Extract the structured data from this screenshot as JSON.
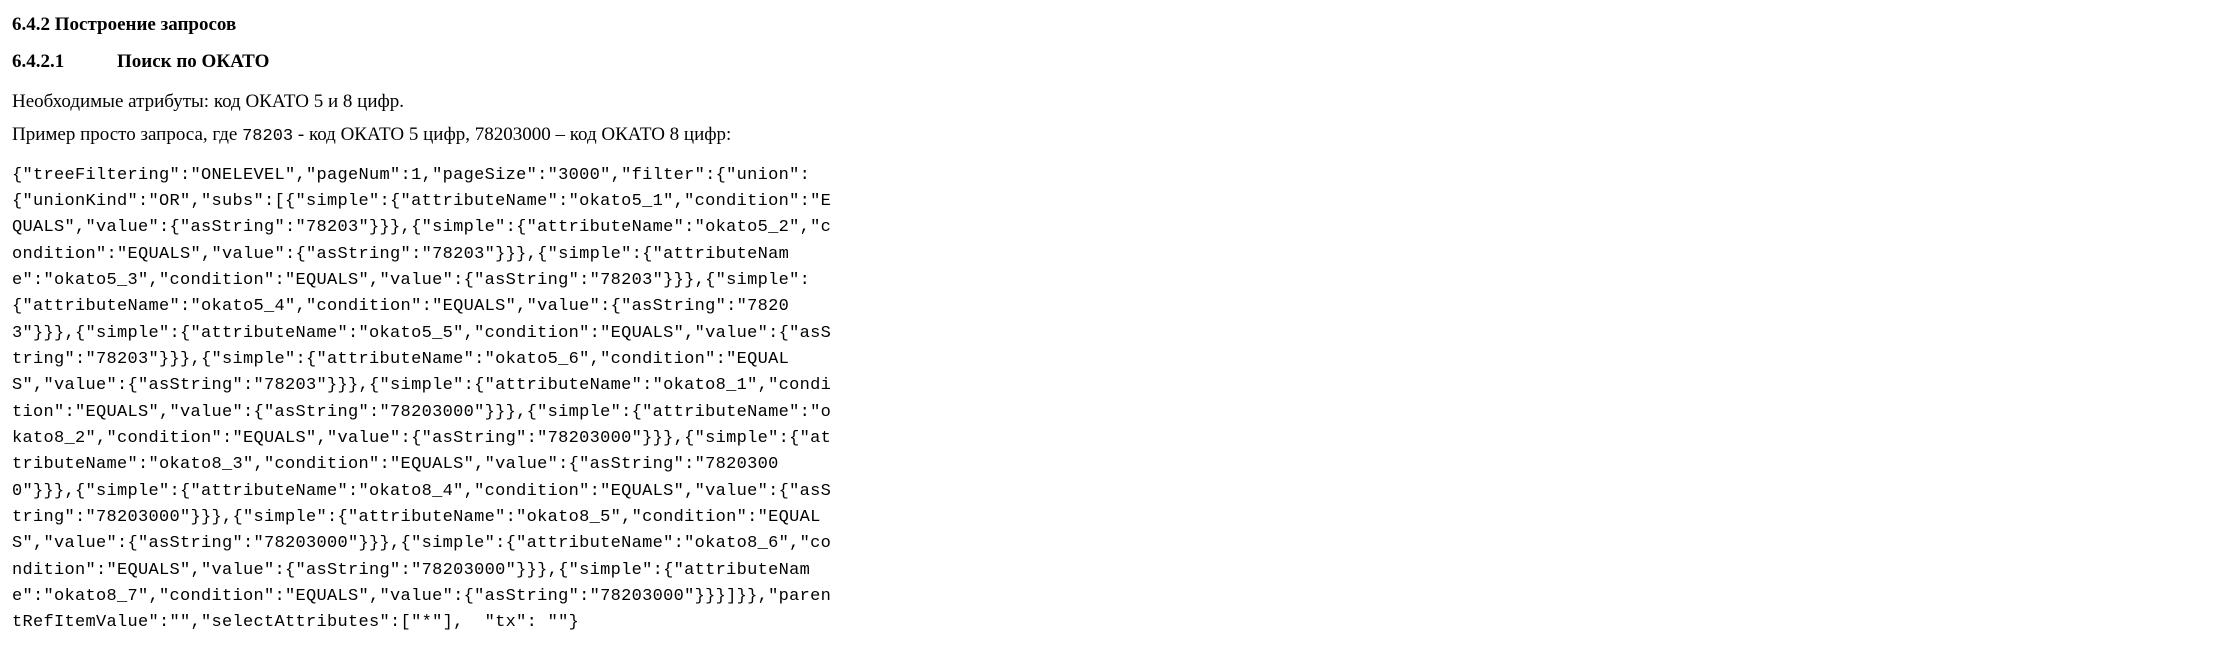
{
  "section": {
    "number": "6.4.2",
    "title": "Построение запросов"
  },
  "subsection": {
    "number": "6.4.2.1",
    "title": "Поиск по ОКАТО"
  },
  "paragraph1": "Необходимые атрибуты: код ОКАТО 5 и 8 цифр.",
  "paragraph2_prefix": "Пример просто запроса, где ",
  "paragraph2_code": "78203",
  "paragraph2_mid": "  -  код ОКАТО 5 цифр, 78203000 – код ОКАТО 8 цифр:",
  "code_block": "{\"treeFiltering\":\"ONELEVEL\",\"pageNum\":1,\"pageSize\":\"3000\",\"filter\":{\"union\":{\"unionKind\":\"OR\",\"subs\":[{\"simple\":{\"attributeName\":\"okato5_1\",\"condition\":\"EQUALS\",\"value\":{\"asString\":\"78203\"}}},{\"simple\":{\"attributeName\":\"okato5_2\",\"condition\":\"EQUALS\",\"value\":{\"asString\":\"78203\"}}},{\"simple\":{\"attributeName\":\"okato5_3\",\"condition\":\"EQUALS\",\"value\":{\"asString\":\"78203\"}}},{\"simple\":{\"attributeName\":\"okato5_4\",\"condition\":\"EQUALS\",\"value\":{\"asString\":\"78203\"}}},{\"simple\":{\"attributeName\":\"okato5_5\",\"condition\":\"EQUALS\",\"value\":{\"asString\":\"78203\"}}},{\"simple\":{\"attributeName\":\"okato5_6\",\"condition\":\"EQUALS\",\"value\":{\"asString\":\"78203\"}}},{\"simple\":{\"attributeName\":\"okato8_1\",\"condition\":\"EQUALS\",\"value\":{\"asString\":\"78203000\"}}},{\"simple\":{\"attributeName\":\"okato8_2\",\"condition\":\"EQUALS\",\"value\":{\"asString\":\"78203000\"}}},{\"simple\":{\"attributeName\":\"okato8_3\",\"condition\":\"EQUALS\",\"value\":{\"asString\":\"78203000\"}}},{\"simple\":{\"attributeName\":\"okato8_4\",\"condition\":\"EQUALS\",\"value\":{\"asString\":\"78203000\"}}},{\"simple\":{\"attributeName\":\"okato8_5\",\"condition\":\"EQUALS\",\"value\":{\"asString\":\"78203000\"}}},{\"simple\":{\"attributeName\":\"okato8_6\",\"condition\":\"EQUALS\",\"value\":{\"asString\":\"78203000\"}}},{\"simple\":{\"attributeName\":\"okato8_7\",\"condition\":\"EQUALS\",\"value\":{\"asString\":\"78203000\"}}}]}},\"parentRefItemValue\":\"\",\"selectAttributes\":[\"*\"],  \"tx\": \"\"}"
}
